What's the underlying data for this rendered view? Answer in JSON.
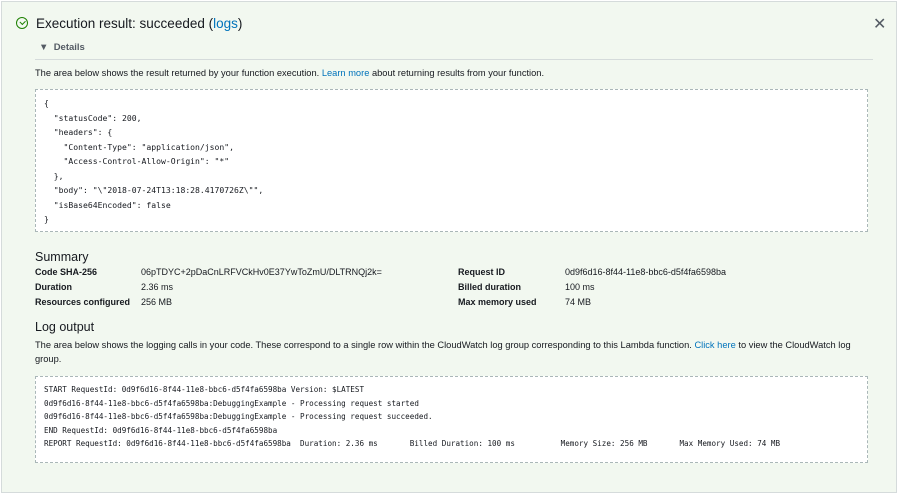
{
  "header": {
    "title_prefix": "Execution result: succeeded (",
    "logs_link": "logs",
    "title_suffix": ")",
    "details_label": "Details",
    "close_icon": "close-icon",
    "status_icon": "check-circle-icon",
    "status_color": "#1d8102"
  },
  "result": {
    "description_before": "The area below shows the result returned by your function execution. ",
    "learn_more": "Learn more",
    "description_after": " about returning results from your function.",
    "lines": [
      "{",
      "  \"statusCode\": 200,",
      "  \"headers\": {",
      "    \"Content-Type\": \"application/json\",",
      "    \"Access-Control-Allow-Origin\": \"*\"",
      "  },",
      "  \"body\": \"\\\"2018-07-24T13:18:28.4170726Z\\\"\",",
      "  \"isBase64Encoded\": false",
      "}"
    ]
  },
  "summary": {
    "heading": "Summary",
    "left": [
      {
        "label": "Code SHA-256",
        "value": "06pTDYC+2pDaCnLRFVCkHv0E37YwToZmU/DLTRNQj2k="
      },
      {
        "label": "Duration",
        "value": "2.36 ms"
      },
      {
        "label": "Resources configured",
        "value": "256 MB"
      }
    ],
    "right": [
      {
        "label": "Request ID",
        "value": "0d9f6d16-8f44-11e8-bbc6-d5f4fa6598ba"
      },
      {
        "label": "Billed duration",
        "value": "100 ms"
      },
      {
        "label": "Max memory used",
        "value": "74 MB"
      }
    ]
  },
  "log": {
    "heading": "Log output",
    "description_before": "The area below shows the logging calls in your code. These correspond to a single row within the CloudWatch log group corresponding to this Lambda function. ",
    "click_here": "Click here",
    "description_after": " to view the CloudWatch log group.",
    "lines": [
      "START RequestId: 0d9f6d16-8f44-11e8-bbc6-d5f4fa6598ba Version: $LATEST",
      "0d9f6d16-8f44-11e8-bbc6-d5f4fa6598ba:DebuggingExample - Processing request started",
      "0d9f6d16-8f44-11e8-bbc6-d5f4fa6598ba:DebuggingExample - Processing request succeeded.",
      "END RequestId: 0d9f6d16-8f44-11e8-bbc6-d5f4fa6598ba",
      "REPORT RequestId: 0d9f6d16-8f44-11e8-bbc6-d5f4fa6598ba  Duration: 2.36 ms       Billed Duration: 100 ms          Memory Size: 256 MB       Max Memory Used: 74 MB"
    ]
  }
}
